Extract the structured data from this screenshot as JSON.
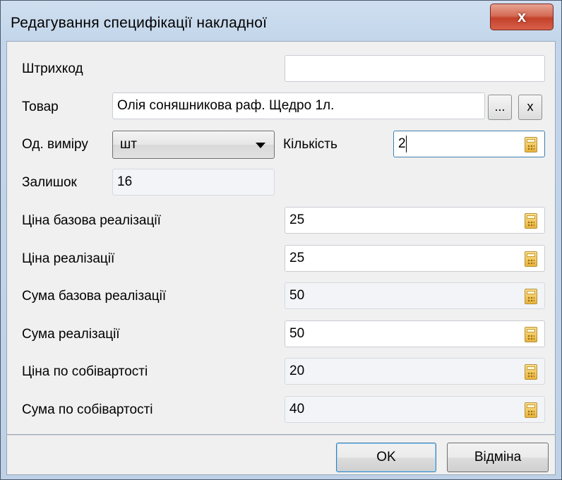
{
  "window": {
    "title": "Редагування специфікації накладної",
    "close_label": "x"
  },
  "form": {
    "barcode": {
      "label": "Штрихкод",
      "value": ""
    },
    "product": {
      "label": "Товар",
      "value": "Олія соняшникова раф.  Щедро 1л.",
      "browse_label": "...",
      "clear_label": "x"
    },
    "unit": {
      "label": "Од. виміру",
      "value": "шт"
    },
    "quantity": {
      "label": "Кількість",
      "value": "2"
    },
    "stock": {
      "label": "Залишок",
      "value": "16"
    },
    "base_price": {
      "label": "Ціна базова реалізації",
      "value": "25"
    },
    "price": {
      "label": "Ціна реалізації",
      "value": "25"
    },
    "base_sum": {
      "label": "Сума базова реалізації",
      "value": "50"
    },
    "sum": {
      "label": "Сума реалізації",
      "value": "50"
    },
    "cost_price": {
      "label": "Ціна по собівартості",
      "value": "20"
    },
    "cost_sum": {
      "label": "Сума по собівартості",
      "value": "40"
    }
  },
  "buttons": {
    "ok": "OK",
    "cancel": "Відміна"
  },
  "icons": {
    "calculator": "calculator-icon",
    "dropdown": "chevron-down-icon"
  }
}
